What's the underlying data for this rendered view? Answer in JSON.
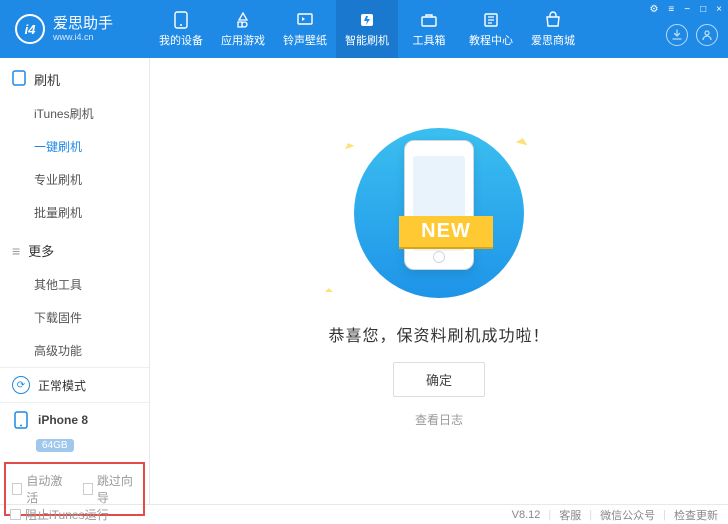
{
  "header": {
    "logo_text": "爱思助手",
    "logo_sub": "www.i4.cn",
    "logo_mark": "i4",
    "window_controls": [
      "⚙",
      "≡",
      "−",
      "□",
      "×"
    ]
  },
  "nav": [
    {
      "label": "我的设备",
      "icon": "device"
    },
    {
      "label": "应用游戏",
      "icon": "apps"
    },
    {
      "label": "铃声壁纸",
      "icon": "ringtone"
    },
    {
      "label": "智能刷机",
      "icon": "flash",
      "active": true
    },
    {
      "label": "工具箱",
      "icon": "toolbox"
    },
    {
      "label": "教程中心",
      "icon": "tutorial"
    },
    {
      "label": "爱思商城",
      "icon": "shop"
    }
  ],
  "sidebar": {
    "sections": [
      {
        "title": "刷机",
        "icon": "phone",
        "items": [
          "iTunes刷机",
          "一键刷机",
          "专业刷机",
          "批量刷机"
        ],
        "active_index": 1
      },
      {
        "title": "更多",
        "icon": "list",
        "items": [
          "其他工具",
          "下载固件",
          "高级功能"
        ],
        "active_index": -1
      }
    ],
    "mode": {
      "label": "正常模式"
    },
    "device": {
      "name": "iPhone 8",
      "storage": "64GB"
    },
    "bottom_checks": [
      "自动激活",
      "跳过向导"
    ]
  },
  "main_panel": {
    "ribbon_text": "NEW",
    "message": "恭喜您，保资料刷机成功啦！",
    "ok_button": "确定",
    "view_log": "查看日志"
  },
  "footer": {
    "block_itunes": "阻止iTunes运行",
    "version": "V8.12",
    "links": [
      "客服",
      "微信公众号",
      "检查更新"
    ]
  }
}
